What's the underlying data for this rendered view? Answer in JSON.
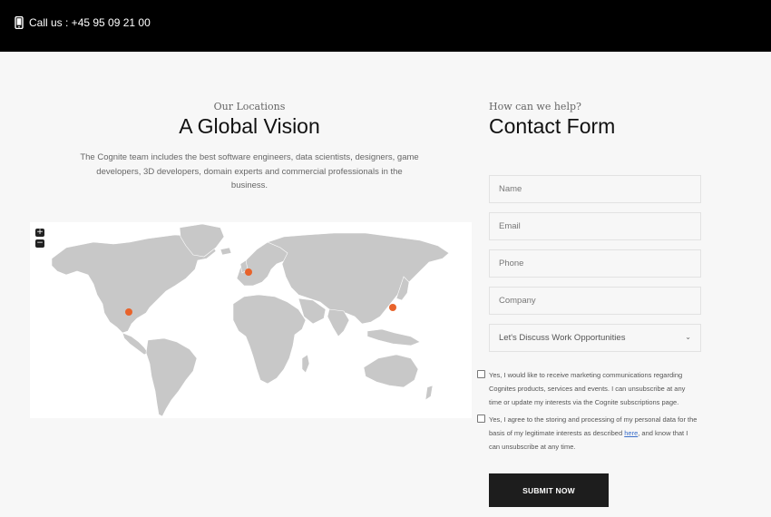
{
  "topbar": {
    "call_text": "Call us : +45 95 09 21 00",
    "icon": "phone-icon"
  },
  "locations": {
    "eyebrow": "Our Locations",
    "title": "A Global Vision",
    "description": "The Cognite team includes the best software engineers, data scientists, designers, game developers, 3D developers, domain experts and commercial professionals in the business.",
    "zoom_in_label": "+",
    "zoom_out_label": "−",
    "marker_color": "#e8632b",
    "land_color": "#c8c8c8"
  },
  "contact": {
    "eyebrow": "How can we help?",
    "title": "Contact Form",
    "fields": {
      "name_placeholder": "Name",
      "email_placeholder": "Email",
      "phone_placeholder": "Phone",
      "company_placeholder": "Company",
      "topic_value": "Let's Discuss Work Opportunities"
    },
    "consent1": "Yes, I would like to receive marketing communications regarding Cognites products, services and events. I can unsubscribe at any time or update my interests via the Cognite subscriptions page.",
    "consent2_before": "Yes, I agree to the storing and processing of my personal data for the basis of my legitimate interests as described ",
    "consent2_link": "here",
    "consent2_after": ", and know that I can unsubscribe at any time.",
    "submit_label": "SUBMIT NOW"
  }
}
